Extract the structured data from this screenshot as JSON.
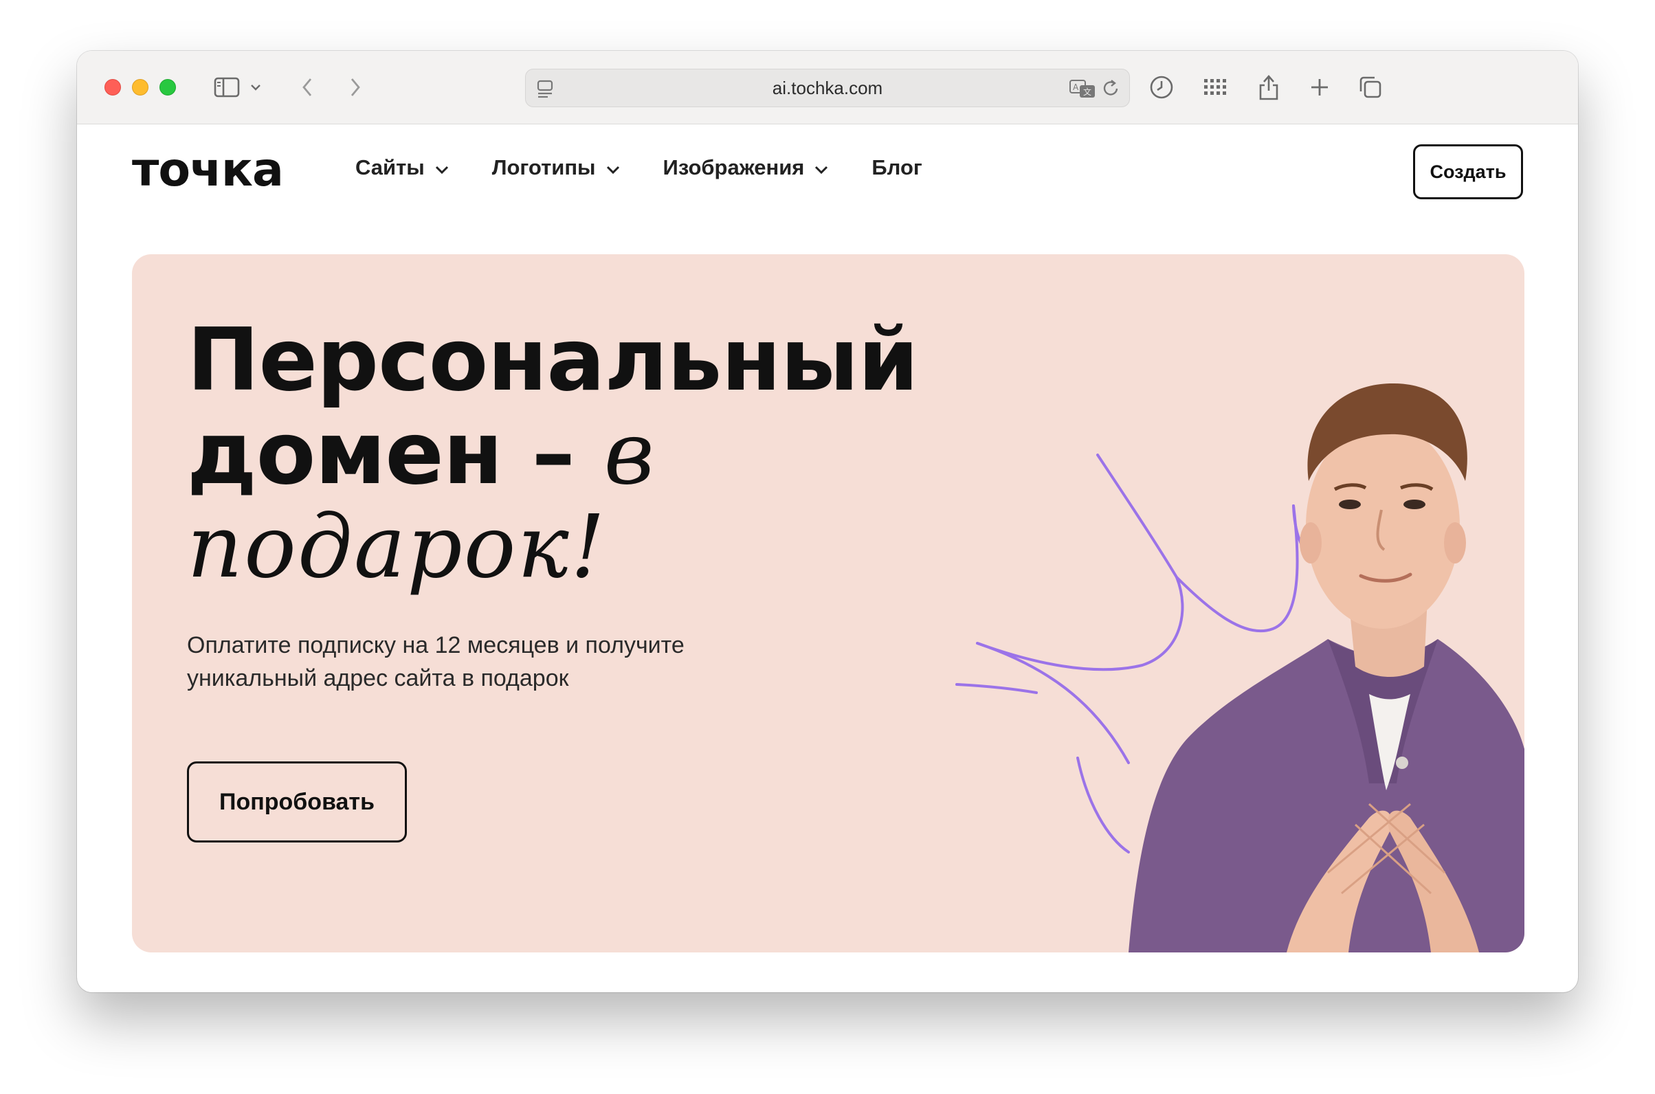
{
  "browser": {
    "url": "ai.tochka.com"
  },
  "header": {
    "logo": "точка",
    "nav": [
      {
        "label": "Сайты",
        "has_dropdown": true
      },
      {
        "label": "Логотипы",
        "has_dropdown": true
      },
      {
        "label": "Изображения",
        "has_dropdown": true
      },
      {
        "label": "Блог",
        "has_dropdown": false
      }
    ],
    "create_label": "Создать"
  },
  "hero": {
    "title_line1": "Персональный",
    "title_line2": "домен –",
    "title_hand1": "в",
    "title_hand2": "подарок!",
    "subtitle": "Оплатите подписку на 12 месяцев и получите уникальный адрес сайта в подарок",
    "cta_label": "Попробовать"
  },
  "colors": {
    "hero_bg": "#f6ded6",
    "accent_line": "#9b73e8",
    "shirt": "#7a5a8c"
  }
}
